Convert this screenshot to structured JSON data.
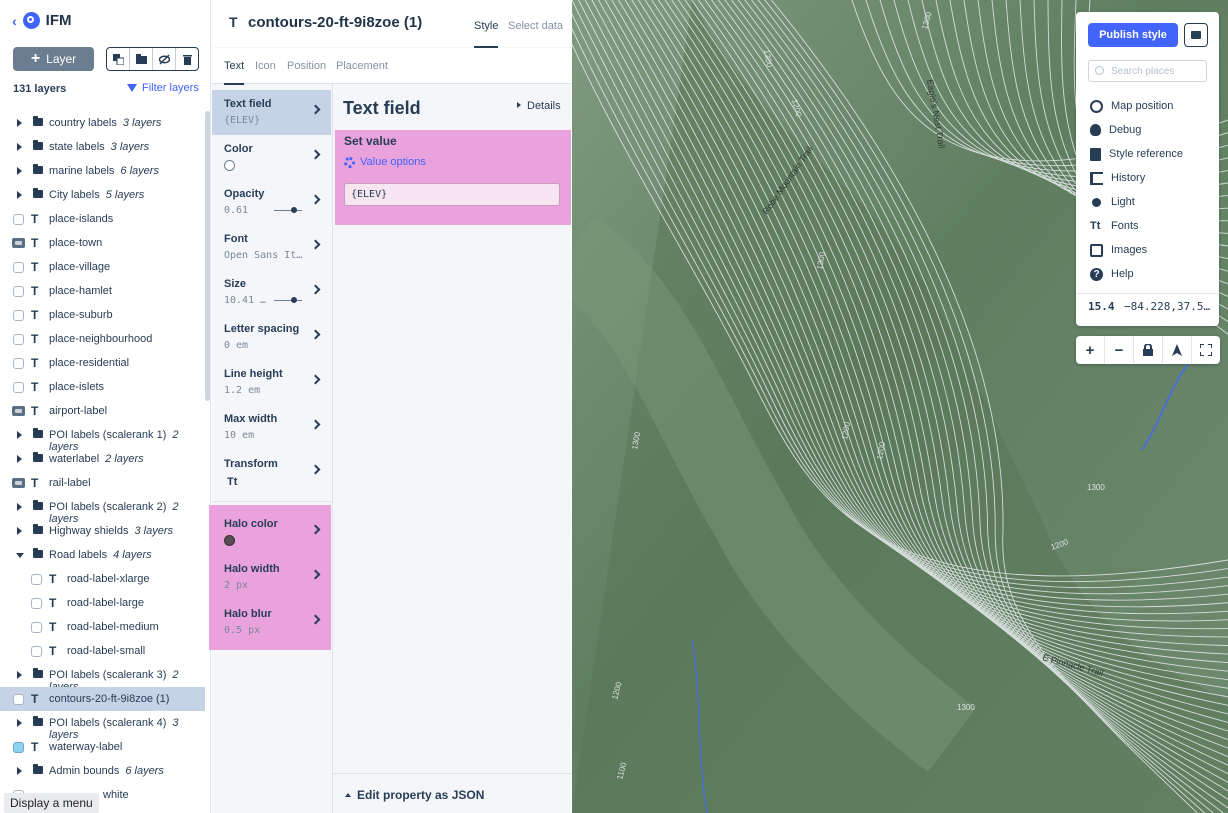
{
  "app": {
    "name": "IFM"
  },
  "left": {
    "add_layer_label": "Layer",
    "layer_count": "131 layers",
    "filter_label": "Filter layers",
    "layers": [
      {
        "name": "country labels",
        "sub": "3 layers",
        "kind": "group"
      },
      {
        "name": "state labels",
        "sub": "3 layers",
        "kind": "group"
      },
      {
        "name": "marine labels",
        "sub": "6 layers",
        "kind": "group"
      },
      {
        "name": "City labels",
        "sub": "5 layers",
        "kind": "group"
      },
      {
        "name": "place-islands",
        "kind": "text"
      },
      {
        "name": "place-town",
        "kind": "textimg"
      },
      {
        "name": "place-village",
        "kind": "text"
      },
      {
        "name": "place-hamlet",
        "kind": "text"
      },
      {
        "name": "place-suburb",
        "kind": "text"
      },
      {
        "name": "place-neighbourhood",
        "kind": "text"
      },
      {
        "name": "place-residential",
        "kind": "text"
      },
      {
        "name": "place-islets",
        "kind": "text"
      },
      {
        "name": "airport-label",
        "kind": "textimg"
      },
      {
        "name": "POI labels (scalerank 1)",
        "sub": "2 layers",
        "kind": "group"
      },
      {
        "name": "waterlabel",
        "sub": "2 layers",
        "kind": "group"
      },
      {
        "name": "rail-label",
        "kind": "textimg"
      },
      {
        "name": "POI labels (scalerank 2)",
        "sub": "2 layers",
        "kind": "group"
      },
      {
        "name": "Highway shields",
        "sub": "3 layers",
        "kind": "group"
      },
      {
        "name": "Road labels",
        "sub": "4 layers",
        "kind": "groupopen"
      },
      {
        "name": "road-label-xlarge",
        "kind": "child"
      },
      {
        "name": "road-label-large",
        "kind": "child"
      },
      {
        "name": "road-label-medium",
        "kind": "child"
      },
      {
        "name": "road-label-small",
        "kind": "child"
      },
      {
        "name": "POI labels (scalerank 3)",
        "sub": "2 layers",
        "kind": "group"
      },
      {
        "name": "contours-20-ft-9i8zoe (1)",
        "kind": "selected"
      },
      {
        "name": "POI labels (scalerank 4)",
        "sub": "3 layers",
        "kind": "group"
      },
      {
        "name": "waterway-label",
        "kind": "textblue"
      },
      {
        "name": "Admin bounds",
        "sub": "6 layers",
        "kind": "group"
      },
      {
        "name": "white",
        "kind": "partial"
      }
    ],
    "tooltip": "Display a menu"
  },
  "mid": {
    "layer_title": "contours-20-ft-9i8zoe (1)",
    "tab_style": "Style",
    "tab_data": "Select data",
    "prop_tabs": [
      "Text",
      "Icon",
      "Position",
      "Placement"
    ],
    "properties": [
      {
        "label": "Text field",
        "value": "{ELEV}"
      },
      {
        "label": "Color",
        "value": ""
      },
      {
        "label": "Opacity",
        "value": "0.61"
      },
      {
        "label": "Font",
        "value": "Open Sans It…"
      },
      {
        "label": "Size",
        "value": "10.41 …"
      },
      {
        "label": "Letter spacing",
        "value": "0 em"
      },
      {
        "label": "Line height",
        "value": "1.2 em"
      },
      {
        "label": "Max width",
        "value": "10 em"
      },
      {
        "label": "Transform",
        "value": "Tt"
      }
    ],
    "halo_properties": [
      {
        "label": "Halo color",
        "value": ""
      },
      {
        "label": "Halo width",
        "value": "2 px"
      },
      {
        "label": "Halo blur",
        "value": "0.5 px"
      }
    ],
    "detail_title": "Text field",
    "details_label": "Details",
    "set_value_label": "Set value",
    "value_options_label": "Value options",
    "field_value": "{ELEV}",
    "edit_json_label": "Edit property as JSON"
  },
  "map": {
    "publish_label": "Publish style",
    "search_placeholder": "Search places",
    "menu": [
      {
        "label": "Map position",
        "icon": "target-icon"
      },
      {
        "label": "Debug",
        "icon": "bug-icon"
      },
      {
        "label": "Style reference",
        "icon": "book-icon"
      },
      {
        "label": "History",
        "icon": "history-icon"
      },
      {
        "label": "Light",
        "icon": "light-icon"
      },
      {
        "label": "Fonts",
        "icon": "fonts-icon"
      },
      {
        "label": "Images",
        "icon": "images-icon"
      },
      {
        "label": "Help",
        "icon": "help-icon"
      }
    ],
    "zoom_level": "15.4",
    "coords": "−84.228,37.5…",
    "labels": [
      "Eagle's Nest Trail",
      "Robe Mountain Trail",
      "E Pinnacle Trail",
      "1300",
      "1200",
      "1300",
      "1300",
      "1200",
      "1200",
      "1300",
      "1200",
      "1300",
      "1200",
      "1100",
      "1300",
      "1200"
    ]
  }
}
